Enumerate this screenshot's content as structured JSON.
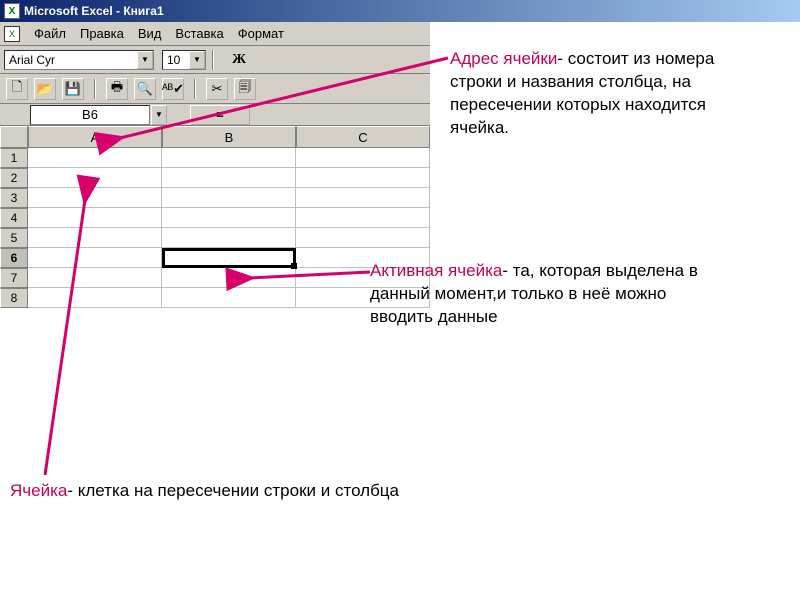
{
  "titlebar": {
    "title": "Microsoft Excel - Книга1",
    "icon_text": "X"
  },
  "menubar": {
    "doc_icon": "X",
    "items": [
      "Файл",
      "Правка",
      "Вид",
      "Вставка",
      "Формат"
    ]
  },
  "toolbar": {
    "font_name": "Arial Cyr",
    "font_size": "10",
    "bold_label": "Ж"
  },
  "toolbar2": {
    "new_icon": "🗋",
    "open_icon": "📂",
    "save_icon": "💾",
    "print_icon": "🖶",
    "preview_icon": "🔍",
    "spell_icon": "ᴬᴮ✔",
    "cut_icon": "✂",
    "copy_icon": "🗐"
  },
  "namebox": {
    "value": "B6",
    "eq": "="
  },
  "grid": {
    "columns": [
      "A",
      "B",
      "C"
    ],
    "rows": [
      "1",
      "2",
      "3",
      "4",
      "5",
      "6",
      "7",
      "8"
    ],
    "active_row": "6",
    "active_col": "B"
  },
  "annotations": {
    "addr_title": "Адрес ячейки",
    "addr_body": "- состоит из номера строки и названия столбца, на пересечении которых находится ячейка.",
    "active_title": "Активная ячейка",
    "active_body": "- та, которая выделена в данный момент,и только в неё можно вводить данные",
    "cell_title": "Ячейка",
    "cell_body": "- клетка на пересечении строки и столбца"
  }
}
